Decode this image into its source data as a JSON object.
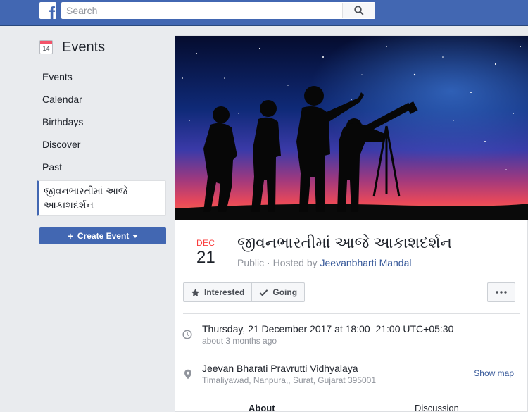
{
  "header": {
    "search_placeholder": "Search"
  },
  "sidebar": {
    "title": "Events",
    "calendar_day": "14",
    "items": [
      {
        "label": "Events"
      },
      {
        "label": "Calendar"
      },
      {
        "label": "Birthdays"
      },
      {
        "label": "Discover"
      },
      {
        "label": "Past"
      }
    ],
    "active_event": "જીવનભારતીમાં આજે આકાશદર્શન",
    "create_button": "Create Event"
  },
  "event": {
    "month": "DEC",
    "day": "21",
    "title": "જીવનભારતીમાં આજે આકાશદર્શન",
    "privacy": "Public",
    "hosted_prefix": "· Hosted by",
    "host": "Jeevanbharti Mandal",
    "interested_label": "Interested",
    "going_label": "Going",
    "datetime": "Thursday, 21 December 2017 at 18:00–21:00 UTC+05:30",
    "relative_time": "about 3 months ago",
    "venue": "Jeevan Bharati Pravrutti Vidhyalaya",
    "address": "Timaliyawad, Nanpura,, Surat, Gujarat 395001",
    "show_map": "Show map",
    "tabs": [
      {
        "label": "About"
      },
      {
        "label": "Discussion"
      }
    ]
  },
  "colors": {
    "brand": "#4267b2",
    "link": "#365899",
    "date_month": "#fa3e3e"
  }
}
